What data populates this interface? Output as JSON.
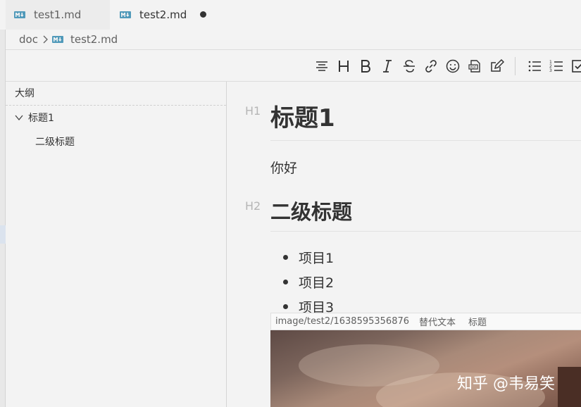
{
  "tabs": [
    {
      "label": "test1.md",
      "active": false,
      "icon": "markdown-icon"
    },
    {
      "label": "test2.md",
      "active": true,
      "icon": "markdown-icon",
      "dirty": true
    }
  ],
  "breadcrumb": {
    "folder": "doc",
    "file": "test2.md"
  },
  "toolbar": {
    "icons": [
      "align-center-icon",
      "heading-icon",
      "bold-icon",
      "italic-icon",
      "strikethrough-icon",
      "link-icon",
      "emoji-icon",
      "pdf-export-icon",
      "edit-icon",
      "bullet-list-icon",
      "numbered-list-icon",
      "task-list-icon"
    ]
  },
  "outline": {
    "title": "大纲",
    "items": [
      {
        "label": "标题1",
        "level": 1,
        "expanded": true
      },
      {
        "label": "二级标题",
        "level": 2
      }
    ]
  },
  "editor": {
    "h1_label": "H1",
    "h1": "标题1",
    "paragraph": "你好",
    "h2_label": "H2",
    "h2": "二级标题",
    "list": [
      "项目1",
      "项目2",
      "项目3"
    ],
    "image": {
      "path": "image/test2/1638595356876",
      "alt": "替代文本",
      "title": "标题",
      "watermark": "知乎 @韦易笑"
    }
  },
  "colors": {
    "background": "#f3f3f3",
    "text": "#333333",
    "muted": "#b5b5b5"
  }
}
